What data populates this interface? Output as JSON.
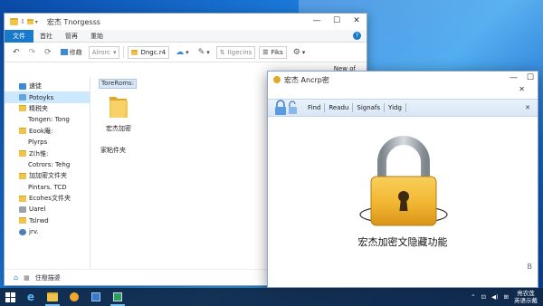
{
  "colors": {
    "accent": "#1979ca",
    "selection": "#cce8ff",
    "padlock_gold": "#f2b632",
    "padlock_shackle": "#9ca3ab",
    "taskbar": "#10284a"
  },
  "explorer": {
    "title": "宏杰 Tnorgesss",
    "window_buttons": {
      "minimize": "—",
      "maximize": "☐",
      "close": "✕"
    },
    "ribbon_tabs": [
      "文件",
      "首社",
      "管再",
      "重始"
    ],
    "toolbar": {
      "organize_label": "修趣",
      "search_placeholder": "Alrorc",
      "combo_label": "Dngc.r4",
      "sort_placeholder": "Ilgecins",
      "filter_label": "Fiks"
    },
    "address_text": "New of",
    "nav_items": [
      {
        "label": "速徒",
        "icon": "star-icon"
      },
      {
        "label": "Potoyks",
        "icon": "picture-folder-icon",
        "selected": true
      },
      {
        "label": "精税夹",
        "icon": "folder-icon"
      },
      {
        "label": "Tongen: Tong",
        "icon": "none"
      },
      {
        "label": "Eook庵:",
        "icon": "folder-icon"
      },
      {
        "label": "Plyrps",
        "icon": "none"
      },
      {
        "label": "Z(h惟:",
        "icon": "folder-icon"
      },
      {
        "label": "Cotrors: Tehg",
        "icon": "none"
      },
      {
        "label": "加加密文件夹",
        "icon": "folder-icon"
      },
      {
        "label": "Pintars. TCD",
        "icon": "none"
      },
      {
        "label": "Ecohes文件夹",
        "icon": "folder-icon"
      },
      {
        "label": "Uarel",
        "icon": "drive-icon"
      },
      {
        "label": "Tslrwd",
        "icon": "folder-icon"
      },
      {
        "label": "jrv.",
        "icon": "network-icon"
      }
    ],
    "column_header": "ToreRoms:",
    "folder_item": "宏杰加密",
    "other_item": "家粘件夹",
    "status_text": "住橙描婆"
  },
  "dialog": {
    "title": "宏杰 Ancrp密",
    "tabs": [
      "Find",
      "Readu",
      "Signafs",
      "Yidg"
    ],
    "caption": "宏杰加密文隐藏功能",
    "corner_text": "B"
  },
  "taskbar": {
    "clock_top": "亮农莲",
    "clock_bottom": "英语示戴"
  }
}
